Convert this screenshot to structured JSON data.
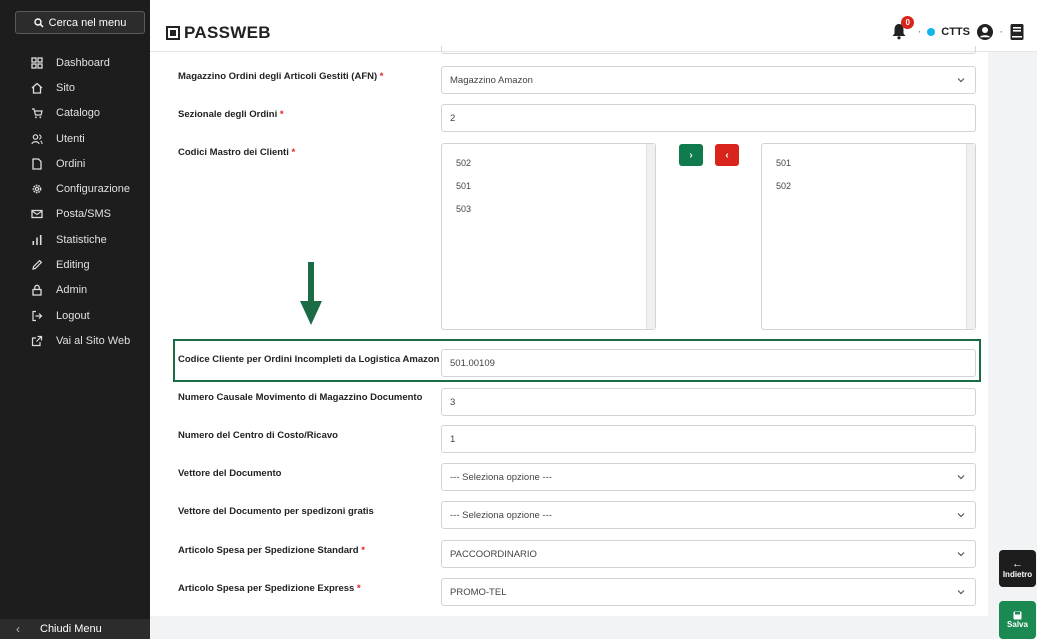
{
  "sidebar": {
    "search_label": "Cerca nel menu",
    "items": [
      {
        "label": "Dashboard",
        "icon": "dashboard-icon"
      },
      {
        "label": "Sito",
        "icon": "home-icon"
      },
      {
        "label": "Catalogo",
        "icon": "cart-icon"
      },
      {
        "label": "Utenti",
        "icon": "users-icon"
      },
      {
        "label": "Ordini",
        "icon": "order-icon"
      },
      {
        "label": "Configurazione",
        "icon": "gear-icon"
      },
      {
        "label": "Posta/SMS",
        "icon": "mail-icon"
      },
      {
        "label": "Statistiche",
        "icon": "chart-icon"
      },
      {
        "label": "Editing",
        "icon": "pencil-icon"
      },
      {
        "label": "Admin",
        "icon": "lock-icon"
      },
      {
        "label": "Logout",
        "icon": "logout-icon"
      },
      {
        "label": "Vai al Sito Web",
        "icon": "external-link-icon"
      }
    ],
    "footer_label": "Chiudi Menu"
  },
  "header": {
    "logo": "PASSWEB",
    "notification_count": "0",
    "user_label": "CTTS"
  },
  "form": {
    "magazzino_label": "Magazzino Ordini degli Articoli Gestiti (AFN)",
    "magazzino_value": "Magazzino Amazon",
    "sezionale_label": "Sezionale degli Ordini",
    "sezionale_value": "2",
    "codici_label": "Codici Mastro dei Clienti",
    "available_options": [
      "502",
      "501",
      "503"
    ],
    "selected_options": [
      "501",
      "502"
    ],
    "codice_cliente_label": "Codice Cliente per Ordini Incompleti da Logistica Amazon",
    "codice_cliente_value": "501.00109",
    "numero_causale_label": "Numero Causale Movimento di Magazzino Documento",
    "numero_causale_value": "3",
    "centro_costo_label": "Numero del Centro di Costo/Ricavo",
    "centro_costo_value": "1",
    "vettore_label": "Vettore del Documento",
    "vettore_value": "--- Seleziona opzione ---",
    "vettore_gratis_label": "Vettore del Documento per spedizoni gratis",
    "vettore_gratis_value": "--- Seleziona opzione ---",
    "articolo_standard_label": "Articolo Spesa per Spedizione Standard",
    "articolo_standard_value": "PACCOORDINARIO",
    "articolo_express_label": "Articolo Spesa per Spedizione Express",
    "articolo_express_value": "PROMO-TEL",
    "required_mark": "*"
  },
  "actions": {
    "back_label": "Indietro",
    "save_label": "Salva",
    "move_right": "›",
    "move_left": "‹"
  },
  "colors": {
    "sidebar_bg": "#1d1d1d",
    "accent_green": "#1b6b45",
    "danger_red": "#d9241b",
    "status_dot": "#15b5e8"
  }
}
